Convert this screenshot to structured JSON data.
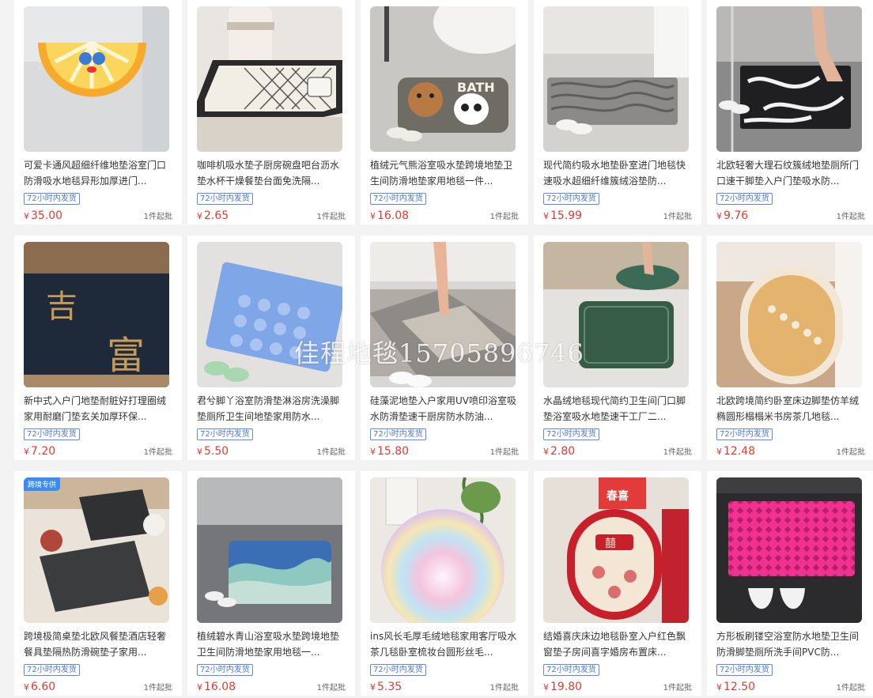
{
  "products": [
    {
      "title": "可爱卡通风超细纤维地垫浴室门口防滑吸水地毯异形加厚进门...",
      "badge": "72小时内发货",
      "currency": "¥",
      "price": "35.00",
      "moq": "1件起批"
    },
    {
      "title": "咖啡机吸水垫子厨房碗盘吧台沥水垫水杯干燥餐垫台面免洗隔...",
      "badge": "72小时内发货",
      "currency": "¥",
      "price": "2.65",
      "moq": "1件起批"
    },
    {
      "title": "植绒元气熊浴室吸水垫跨境地垫卫生间防滑地垫家用地毯一件...",
      "badge": "72小时内发货",
      "currency": "¥",
      "price": "16.08",
      "moq": "1件起批"
    },
    {
      "title": "现代简约吸水地垫卧室进门地毯快速吸水超细纤维簇绒浴垫防...",
      "badge": "72小时内发货",
      "currency": "¥",
      "price": "15.99",
      "moq": "1件起批"
    },
    {
      "title": "北欧轻奢大理石纹簇绒地垫厕所门口速干脚垫入户门垫吸水防...",
      "badge": "72小时内发货",
      "currency": "¥",
      "price": "9.76",
      "moq": "1件起批"
    },
    {
      "title": "新中式入户门地垫耐脏好打理圈绒家用耐磨门垫玄关加厚环保...",
      "badge": "72小时内发货",
      "currency": "¥",
      "price": "7.20",
      "moq": "1件起批"
    },
    {
      "title": "君兮脚丫浴室防滑垫淋浴房洗澡脚垫厕所卫生间地垫家用防水...",
      "badge": "72小时内发货",
      "currency": "¥",
      "price": "5.50",
      "moq": "1件起批"
    },
    {
      "title": "硅藻泥地垫入户家用UV喷印浴室吸水防滑垫速干厨房防水防油...",
      "badge": "72小时内发货",
      "currency": "¥",
      "price": "15.80",
      "moq": "1件起批"
    },
    {
      "title": "水晶绒地毯现代简约卫生间门口脚垫浴室吸水地垫速干工厂二...",
      "badge": "72小时内发货",
      "currency": "¥",
      "price": "2.80",
      "moq": "1件起批"
    },
    {
      "title": "北欧跨境简约卧室床边脚垫仿羊绒椭圆形榻榻米书房茶几地毯...",
      "badge": "72小时内发货",
      "currency": "¥",
      "price": "12.48",
      "moq": "1件起批"
    },
    {
      "title": "跨境极简桌垫北欧风餐垫酒店轻奢餐具垫隔热防滑碗垫子家用...",
      "badge": "72小时内发货",
      "currency": "¥",
      "price": "6.60",
      "moq": "1件起批",
      "tag": "跨境专供"
    },
    {
      "title": "植绒碧水青山浴室吸水垫跨境地垫卫生间防滑地垫家用地毯一...",
      "badge": "72小时内发货",
      "currency": "¥",
      "price": "16.08",
      "moq": "1件起批"
    },
    {
      "title": "ins风长毛厚毛绒地毯家用客厅吸水茶几毯卧室梳妆台圆形丝毛...",
      "badge": "72小时内发货",
      "currency": "¥",
      "price": "5.35",
      "moq": "1件起批"
    },
    {
      "title": "结婚喜庆床边地毯卧室入户红色飘窗垫子房间喜字婚房布置床...",
      "badge": "72小时内发货",
      "currency": "¥",
      "price": "19.80",
      "moq": "1件起批"
    },
    {
      "title": "方形板刷镂空浴室防水地垫卫生间防滑脚垫厕所洗手间PVC防...",
      "badge": "72小时内发货",
      "currency": "¥",
      "price": "12.50",
      "moq": "1件起批"
    }
  ],
  "image_text": {
    "bath": "BATH",
    "xi": "囍",
    "chunxi": "春喜"
  },
  "watermark": "佳程地毯15705896746",
  "colors": {
    "price": "#e8382f",
    "badge": "#4a78d0",
    "tag": "#3a8cf0"
  }
}
